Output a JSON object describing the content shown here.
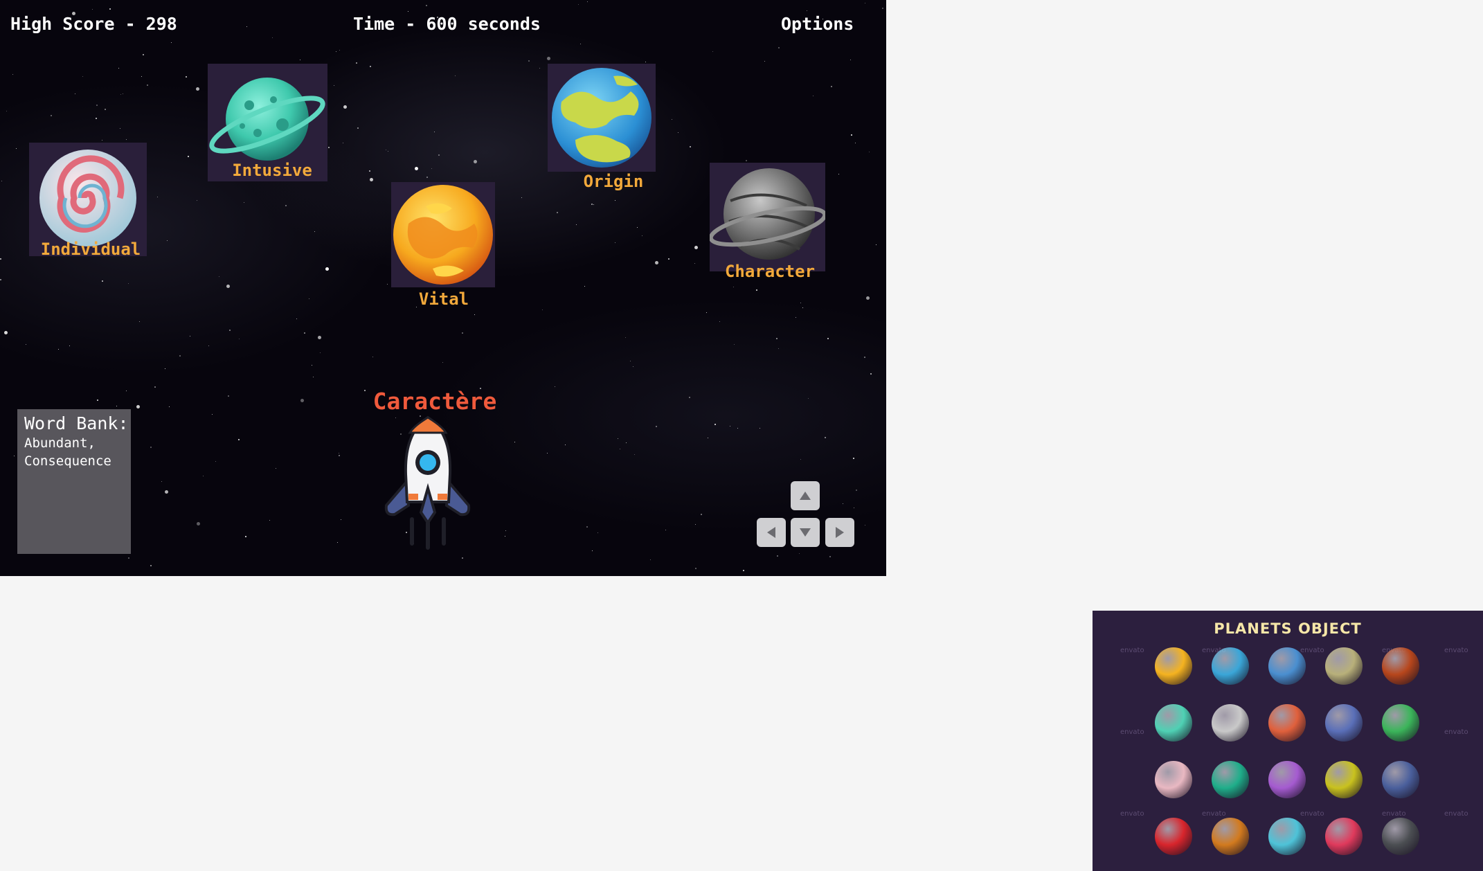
{
  "hud": {
    "high_score": "High Score - 298",
    "time": "Time - 600 seconds",
    "options": "Options"
  },
  "planets": [
    {
      "label": "Intusive",
      "style": "teal-ringed"
    },
    {
      "label": "Origin",
      "style": "blue-yellow"
    },
    {
      "label": "Individual",
      "style": "pink-swirl"
    },
    {
      "label": "Vital",
      "style": "yellow-orange"
    },
    {
      "label": "Character",
      "style": "gray-ringed"
    }
  ],
  "current_word": "Caractère",
  "word_bank": {
    "title": "Word Bank:",
    "words": "Abundant, Consequence"
  },
  "controls": {
    "up": "arrow-up-icon",
    "down": "arrow-down-icon",
    "left": "arrow-left-icon",
    "right": "arrow-right-icon"
  },
  "sprite_sheet": {
    "title": "PLANETS OBJECT",
    "watermark": "envato",
    "planets": [
      "#f5b320",
      "#3aa6d8",
      "#4a8fd0",
      "#b8b07a",
      "#b7461c",
      "#4fd1b4",
      "#c9c9c9",
      "#e0603c",
      "#5a6fb8",
      "#3bb55a",
      "#e9b8c2",
      "#1fae8a",
      "#a55bd0",
      "#c9c21e",
      "#4a5f9c",
      "#d8252c",
      "#d27a1e",
      "#4ec3d8",
      "#e03a5c",
      "#4b4e52"
    ]
  },
  "colors": {
    "space": "#07050d",
    "label": "#f2a93b",
    "current_word": "#ef5a3c",
    "word_bank_bg": "#58565c"
  }
}
